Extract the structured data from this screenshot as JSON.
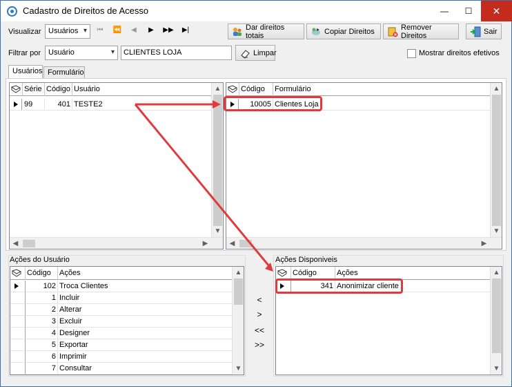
{
  "window": {
    "title": "Cadastro de Direitos de Acesso",
    "minimize": "—",
    "maximize": "☐",
    "close": "✕"
  },
  "toolbar": {
    "view_label": "Visualizar",
    "view_value": "Usuários",
    "nav_first": "⏮",
    "nav_prev_page": "⏪",
    "nav_prev": "◀",
    "nav_next": "▶",
    "nav_next_page": "▶▶",
    "nav_last": "▶|",
    "give_all_label": "Dar direitos totais",
    "copy_label": "Copiar Direitos",
    "remove_label": "Remover Direitos",
    "exit_label": "Sair"
  },
  "filter": {
    "label": "Filtrar por",
    "field_value": "Usuário",
    "text_value": "CLIENTES LOJA",
    "clear_label": "Limpar",
    "show_effective_label": "Mostrar direitos efetivos"
  },
  "tabs": [
    {
      "label": "Usuários"
    },
    {
      "label": "Formulário"
    }
  ],
  "users_grid": {
    "columns": [
      "Série",
      "Código",
      "Usuário"
    ],
    "rows": [
      {
        "serie": "99",
        "codigo": "401",
        "usuario": "TESTE2"
      }
    ]
  },
  "forms_grid": {
    "columns": [
      "Código",
      "Formulário"
    ],
    "rows": [
      {
        "codigo": "10005",
        "formulario": "Clientes Loja"
      }
    ]
  },
  "user_actions": {
    "title": "Ações do Usuário",
    "columns": [
      "Código",
      "Ações"
    ],
    "rows": [
      {
        "codigo": "102",
        "acao": "Troca Clientes"
      },
      {
        "codigo": "1",
        "acao": "Incluir"
      },
      {
        "codigo": "2",
        "acao": "Alterar"
      },
      {
        "codigo": "3",
        "acao": "Excluir"
      },
      {
        "codigo": "4",
        "acao": "Designer"
      },
      {
        "codigo": "5",
        "acao": "Exportar"
      },
      {
        "codigo": "6",
        "acao": "Imprimir"
      },
      {
        "codigo": "7",
        "acao": "Consultar"
      }
    ]
  },
  "move_buttons": {
    "add_one": "<",
    "remove_one": ">",
    "add_all": "<<",
    "remove_all": ">>"
  },
  "available_actions": {
    "title": "Ações Disponiveis",
    "columns": [
      "Código",
      "Ações"
    ],
    "rows": [
      {
        "codigo": "341",
        "acao": "Anonimizar cliente"
      }
    ]
  },
  "colors": {
    "annotation": "#e03a3e",
    "title_border": "#3c6fb0",
    "close_bg": "#c42b1c"
  }
}
